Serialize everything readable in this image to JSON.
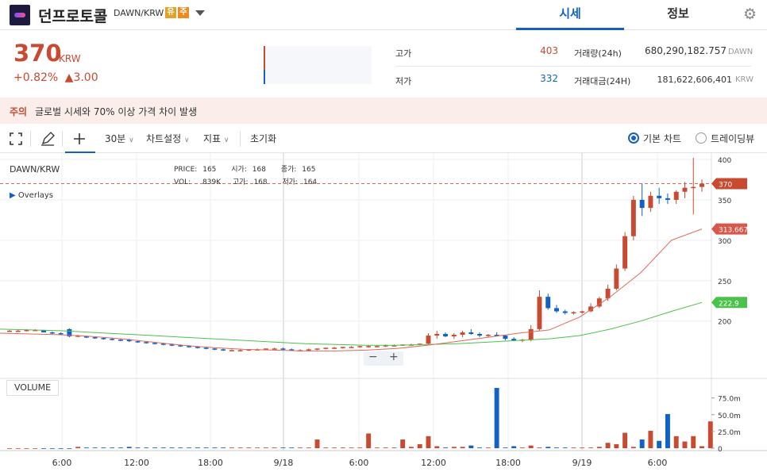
{
  "header": {
    "coin_name": "던프로토콜",
    "pair": "DAWN/KRW",
    "badge1": "유",
    "badge2": "주",
    "tab_quote": "시세",
    "tab_info": "정보",
    "icons": [
      "logo-icon",
      "dropdown-caret-icon",
      "gear-icon"
    ]
  },
  "price": {
    "current": "370",
    "currency": "KRW",
    "change_pct": "+0.82%",
    "change_abs": "▲3.00"
  },
  "stats": {
    "high_label": "고가",
    "high_value": "403",
    "low_label": "저가",
    "low_value": "332",
    "volume_label": "거래량(24h)",
    "volume_value": "680,290,182.757",
    "volume_unit": "DAWN",
    "turnover_label": "거래대금(24H)",
    "turnover_value": "181,622,606,401",
    "turnover_unit": "KRW",
    "colors": {
      "up": "#c84a31",
      "down": "#1261c4"
    }
  },
  "warning": {
    "label": "주의",
    "text": "글로벌 시세와 70% 이상 가격 차이 발생"
  },
  "toolbar": {
    "interval": "30분",
    "chart_settings": "차트설정",
    "indicators": "지표",
    "reset": "초기화",
    "view_basic": "기본 차트",
    "view_tradingview": "트레이딩뷰",
    "icons": [
      "fullscreen-icon",
      "draw-pen-icon",
      "crosshair-icon"
    ]
  },
  "chart_info": {
    "symbol": "DAWN/KRW",
    "overlays": "Overlays",
    "price_k": "PRICE:",
    "price_v": "165",
    "open_k": "시가:",
    "open_v": "168",
    "close_k": "종가:",
    "close_v": "165",
    "vol_k": "VOL:",
    "vol_v": "839K",
    "high_k": "고가:",
    "high_v": "168",
    "low_k": "저가:",
    "low_v": "164",
    "volume_title": "VOLUME",
    "zoom_minus": "−",
    "zoom_plus": "+",
    "price_tag": "370",
    "ma_short_tag": "313.667",
    "ma_long_tag": "222.9"
  },
  "chart_data": {
    "type": "candlestick",
    "ylim": [
      130,
      400
    ],
    "y_ticks": [
      200,
      250,
      300,
      350,
      400
    ],
    "x_tick_labels": [
      "6:00",
      "12:00",
      "18:00",
      "9/18",
      "6:00",
      "12:00",
      "18:00",
      "9/19",
      "6:00"
    ],
    "volume_ticks": [
      "75.0m",
      "50.0m",
      "25.0m",
      "0"
    ],
    "ma_colors": {
      "short": "#e0685a",
      "long": "#4cc24c"
    },
    "ma_short": [
      185,
      184,
      183,
      181,
      178,
      174,
      170,
      167,
      165,
      164,
      163,
      163,
      164,
      166,
      170,
      175,
      180,
      185,
      189,
      205,
      230,
      260,
      300,
      314
    ],
    "ma_long": [
      190,
      189,
      188,
      186,
      184,
      182,
      180,
      178,
      176,
      174,
      172,
      171,
      170,
      170,
      171,
      172,
      174,
      176,
      178,
      182,
      190,
      200,
      212,
      223
    ],
    "candles_ohlc": [
      [
        188,
        189,
        187,
        188
      ],
      [
        188,
        189,
        187,
        188
      ],
      [
        188,
        190,
        187,
        189
      ],
      [
        189,
        190,
        188,
        189
      ],
      [
        189,
        189,
        186,
        186
      ],
      [
        186,
        187,
        184,
        185
      ],
      [
        185,
        186,
        183,
        184
      ],
      [
        190,
        191,
        180,
        181
      ],
      [
        181,
        183,
        180,
        182
      ],
      [
        181,
        182,
        179,
        180
      ],
      [
        180,
        181,
        178,
        179
      ],
      [
        179,
        180,
        177,
        178
      ],
      [
        178,
        179,
        176,
        177
      ],
      [
        177,
        178,
        175,
        176
      ],
      [
        177,
        178,
        174,
        175
      ],
      [
        175,
        176,
        173,
        174
      ],
      [
        174,
        175,
        172,
        173
      ],
      [
        173,
        174,
        171,
        172
      ],
      [
        172,
        173,
        170,
        171
      ],
      [
        171,
        172,
        169,
        170
      ],
      [
        170,
        171,
        168,
        169
      ],
      [
        169,
        170,
        167,
        168
      ],
      [
        168,
        169,
        166,
        167
      ],
      [
        167,
        168,
        165,
        166
      ],
      [
        166,
        167,
        164,
        165
      ],
      [
        165,
        166,
        163,
        164
      ],
      [
        164,
        165,
        163,
        164
      ],
      [
        164,
        165,
        163,
        164
      ],
      [
        164,
        165,
        163,
        165
      ],
      [
        165,
        166,
        164,
        165
      ],
      [
        165,
        166,
        164,
        166
      ],
      [
        166,
        167,
        165,
        166
      ],
      [
        166,
        167,
        164,
        165
      ],
      [
        165,
        166,
        163,
        164
      ],
      [
        164,
        165,
        163,
        164
      ],
      [
        164,
        166,
        163,
        165
      ],
      [
        165,
        166,
        164,
        166
      ],
      [
        166,
        167,
        165,
        167
      ],
      [
        167,
        168,
        166,
        167
      ],
      [
        167,
        168,
        166,
        168
      ],
      [
        168,
        169,
        167,
        168
      ],
      [
        168,
        169,
        167,
        169
      ],
      [
        168,
        170,
        167,
        169
      ],
      [
        169,
        170,
        168,
        169
      ],
      [
        169,
        171,
        168,
        170
      ],
      [
        170,
        171,
        169,
        170
      ],
      [
        170,
        171,
        169,
        171
      ],
      [
        171,
        172,
        170,
        171
      ],
      [
        171,
        172,
        170,
        172
      ],
      [
        172,
        185,
        171,
        182
      ],
      [
        182,
        188,
        178,
        184
      ],
      [
        184,
        186,
        180,
        181
      ],
      [
        181,
        185,
        178,
        183
      ],
      [
        183,
        188,
        180,
        186
      ],
      [
        186,
        190,
        183,
        184
      ],
      [
        184,
        186,
        180,
        182
      ],
      [
        182,
        184,
        180,
        183
      ],
      [
        183,
        186,
        181,
        182
      ],
      [
        182,
        183,
        176,
        178
      ],
      [
        178,
        180,
        175,
        176
      ],
      [
        176,
        178,
        174,
        177
      ],
      [
        177,
        195,
        175,
        190
      ],
      [
        190,
        238,
        188,
        230
      ],
      [
        230,
        234,
        214,
        216
      ],
      [
        216,
        220,
        210,
        212
      ],
      [
        212,
        214,
        208,
        210
      ],
      [
        210,
        212,
        208,
        211
      ],
      [
        211,
        213,
        209,
        212
      ],
      [
        212,
        222,
        211,
        218
      ],
      [
        218,
        230,
        216,
        228
      ],
      [
        228,
        245,
        225,
        240
      ],
      [
        240,
        270,
        238,
        265
      ],
      [
        265,
        310,
        262,
        305
      ],
      [
        305,
        355,
        300,
        350
      ],
      [
        350,
        370,
        330,
        340
      ],
      [
        340,
        360,
        335,
        355
      ],
      [
        355,
        365,
        345,
        352
      ],
      [
        352,
        358,
        345,
        350
      ],
      [
        350,
        362,
        345,
        360
      ],
      [
        360,
        372,
        352,
        365
      ],
      [
        365,
        402,
        332,
        366
      ],
      [
        366,
        375,
        360,
        370
      ]
    ],
    "volumes_m": [
      0,
      0,
      0,
      0,
      0,
      0,
      0,
      0,
      2,
      1,
      1,
      1,
      1,
      1,
      2,
      1,
      1,
      1,
      1,
      1,
      1,
      1,
      1,
      1,
      1,
      1,
      1,
      1,
      1,
      1,
      1,
      1,
      1,
      1,
      1,
      1,
      13,
      1,
      1,
      1,
      1,
      1,
      22,
      1,
      1,
      1,
      13,
      2,
      6,
      18,
      3,
      1,
      2,
      2,
      4,
      1,
      1,
      96,
      1,
      3,
      1,
      4,
      1,
      2,
      1,
      1,
      1,
      1,
      1,
      2,
      8,
      6,
      23,
      2,
      13,
      26,
      11,
      51,
      18,
      10,
      18,
      3,
      40
    ]
  }
}
